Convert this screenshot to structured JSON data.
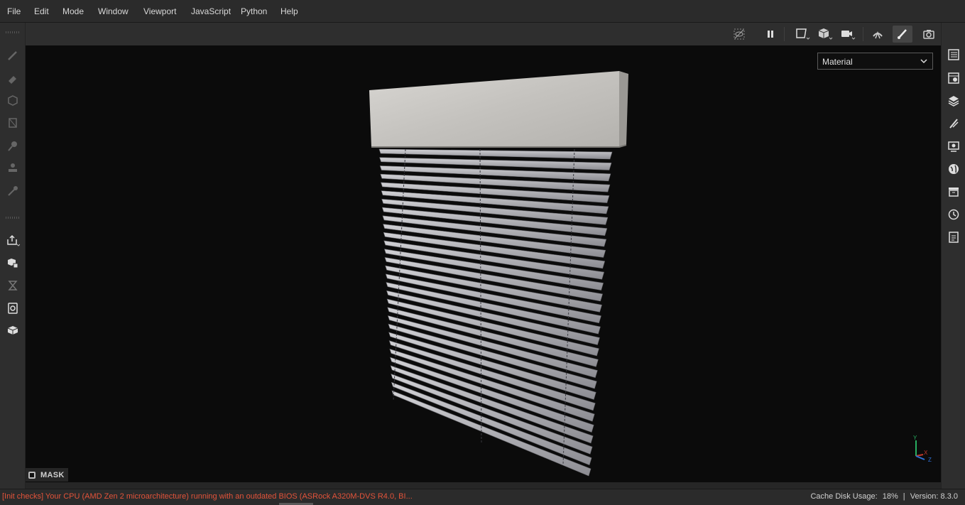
{
  "menu": [
    "File",
    "Edit",
    "Mode",
    "Window",
    "Viewport",
    "JavaScript",
    "Python",
    "Help"
  ],
  "viewport": {
    "render_mode": "Material",
    "mask_label": "MASK",
    "axes": {
      "y": "Y",
      "x": "X",
      "z": "Z"
    }
  },
  "toolbar": {
    "icons": [
      "hide-icon",
      "pause-icon",
      "frame-icon",
      "cube-icon",
      "camera-icon",
      "environment-icon",
      "paint-icon",
      "screenshot-icon"
    ]
  },
  "left_tools": [
    "brush-icon",
    "eraser-icon",
    "projection-icon",
    "polygon-fill-icon",
    "smudge-icon",
    "clone-icon",
    "color-picker-icon",
    "export-icon",
    "bake-icon",
    "iray-icon",
    "texture-set-icon",
    "3d-view-icon"
  ],
  "right_panels": [
    "layers-list-icon",
    "texture-set-settings-icon",
    "layer-stack-icon",
    "brush-properties-icon",
    "display-settings-icon",
    "environment-icon",
    "shelf-icon",
    "history-icon",
    "log-icon"
  ],
  "status": {
    "message": "[Init checks] Your CPU (AMD Zen 2 microarchitecture) running with an outdated BIOS (ASRock A320M-DVS R4.0, BI...",
    "cache_label": "Cache Disk Usage:",
    "cache_value": "18%",
    "separator": "|",
    "version": "Version: 8.3.0"
  },
  "colors": {
    "status_warning": "#e3533a",
    "viewport_bg": "#0b0b0b",
    "axis_x": "#c0392b",
    "axis_y": "#27ae60",
    "axis_z": "#2e6fd6"
  }
}
